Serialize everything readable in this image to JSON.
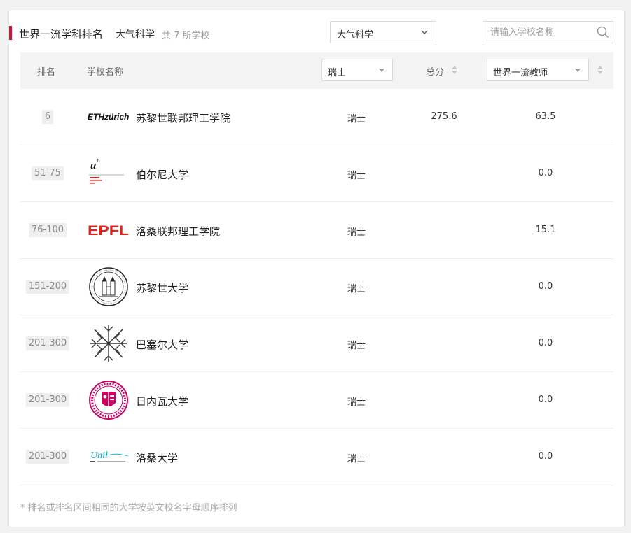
{
  "header": {
    "title": "世界一流学科排名",
    "subject": "大气科学",
    "count_text": "共 7 所学校"
  },
  "filters": {
    "subject_select": "大气科学",
    "search_placeholder": "请输入学校名称"
  },
  "table": {
    "columns": {
      "rank": "排名",
      "school": "学校名称",
      "country_filter": "瑞士",
      "total": "总分",
      "indicator_filter": "世界一流教师"
    },
    "rows": [
      {
        "rank": "6",
        "logo_text": "ETHzürich",
        "name": "苏黎世联邦理工学院",
        "country": "瑞士",
        "total": "275.6",
        "indicator": "63.5"
      },
      {
        "rank": "51-75",
        "logo_text": "u",
        "name": "伯尔尼大学",
        "country": "瑞士",
        "total": "",
        "indicator": "0.0"
      },
      {
        "rank": "76-100",
        "logo_text": "EPFL",
        "name": "洛桑联邦理工学院",
        "country": "瑞士",
        "total": "",
        "indicator": "15.1"
      },
      {
        "rank": "151-200",
        "logo_text": "",
        "name": "苏黎世大学",
        "country": "瑞士",
        "total": "",
        "indicator": "0.0"
      },
      {
        "rank": "201-300",
        "logo_text": "",
        "name": "巴塞尔大学",
        "country": "瑞士",
        "total": "",
        "indicator": "0.0"
      },
      {
        "rank": "201-300",
        "logo_text": "",
        "name": "日内瓦大学",
        "country": "瑞士",
        "total": "",
        "indicator": "0.0"
      },
      {
        "rank": "201-300",
        "logo_text": "Unil",
        "name": "洛桑大学",
        "country": "瑞士",
        "total": "",
        "indicator": "0.0"
      }
    ]
  },
  "footnote": "* 排名或排名区间相同的大学按英文校名字母顺序排列",
  "colors": {
    "accent": "#d80f35",
    "epfl": "#e2231a",
    "geneva": "#cf0063",
    "unil": "#00a4d4"
  },
  "icons": {
    "chevron": "chevron-down-icon",
    "search": "search-icon",
    "sort": "sort-icon",
    "dropdown": "caret-down-icon"
  }
}
